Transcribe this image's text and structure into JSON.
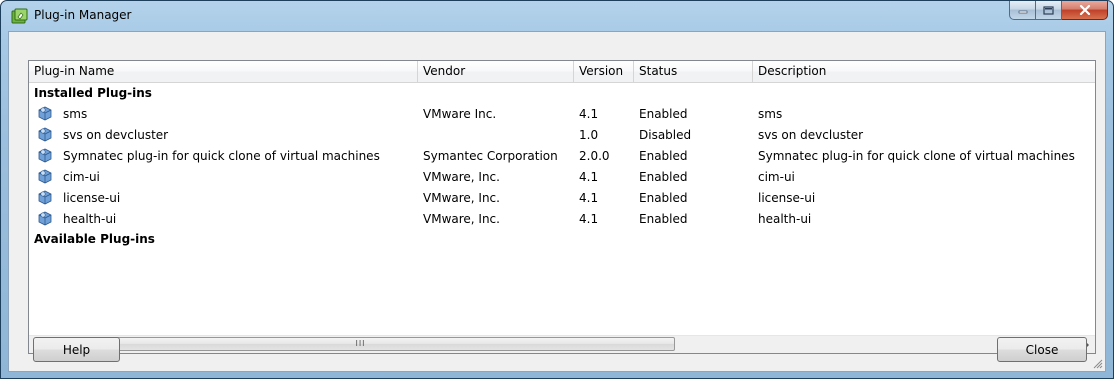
{
  "window": {
    "title": "Plug-in Manager",
    "icons": {
      "app": "plug-in-manager-icon",
      "minimize": "minimize-icon",
      "maximize": "maximize-icon",
      "close": "close-icon"
    }
  },
  "columns": [
    {
      "key": "name",
      "label": "Plug-in Name"
    },
    {
      "key": "vendor",
      "label": "Vendor"
    },
    {
      "key": "version",
      "label": "Version"
    },
    {
      "key": "status",
      "label": "Status"
    },
    {
      "key": "description",
      "label": "Description"
    }
  ],
  "groups": {
    "installed": "Installed Plug-ins",
    "available": "Available Plug-ins"
  },
  "plugins": [
    {
      "icon": "plugin-icon",
      "name": "sms",
      "vendor": "VMware Inc.",
      "version": "4.1",
      "status": "Enabled",
      "description": "sms"
    },
    {
      "icon": "plugin-icon",
      "name": "svs on devcluster",
      "vendor": "",
      "version": "1.0",
      "status": "Disabled",
      "description": "svs on devcluster"
    },
    {
      "icon": "plugin-icon",
      "name": "Symnatec plug-in for quick clone of virtual machines",
      "vendor": "Symantec Corporation",
      "version": "2.0.0",
      "status": "Enabled",
      "description": "Symnatec plug-in for quick clone of virtual machines"
    },
    {
      "icon": "plugin-icon",
      "name": "cim-ui",
      "vendor": "VMware, Inc.",
      "version": "4.1",
      "status": "Enabled",
      "description": "cim-ui"
    },
    {
      "icon": "plugin-icon",
      "name": "license-ui",
      "vendor": "VMware, Inc.",
      "version": "4.1",
      "status": "Enabled",
      "description": "license-ui"
    },
    {
      "icon": "plugin-icon",
      "name": "health-ui",
      "vendor": "VMware, Inc.",
      "version": "4.1",
      "status": "Enabled",
      "description": "health-ui"
    }
  ],
  "scrollbar": {
    "grip": "III"
  },
  "buttons": {
    "help": "Help",
    "close": "Close"
  },
  "colors": {
    "title_bar": "#a6c9e6",
    "close_button": "#c0402a",
    "client": "#f0f0f0",
    "plugin_icon": "#4a7fc0"
  }
}
